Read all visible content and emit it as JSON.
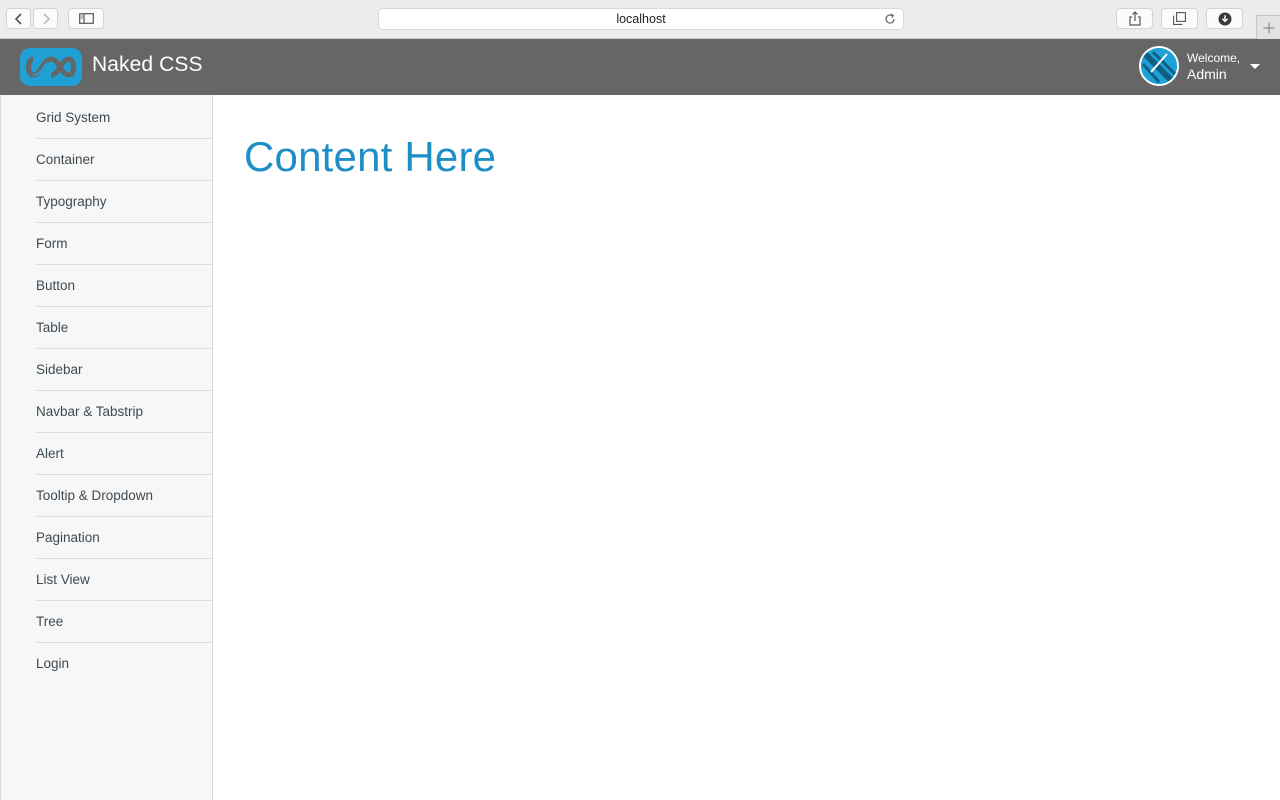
{
  "browser": {
    "address": "localhost",
    "icons": {
      "back": "chevron-left-icon",
      "forward": "chevron-right-icon",
      "sidebar": "sidebar-toggle-icon",
      "reload": "reload-icon",
      "share": "share-icon",
      "tabs": "tabs-overview-icon",
      "downloads": "download-icon",
      "new_tab": "plus-icon"
    }
  },
  "header": {
    "brand": "Naked CSS",
    "welcome": "Welcome,",
    "user": "Admin",
    "colors": {
      "bar": "#666666",
      "logo": "#1fa1d6"
    }
  },
  "sidebar": {
    "items": [
      {
        "label": "Grid System"
      },
      {
        "label": "Container"
      },
      {
        "label": "Typography"
      },
      {
        "label": "Form"
      },
      {
        "label": "Button"
      },
      {
        "label": "Table"
      },
      {
        "label": "Sidebar"
      },
      {
        "label": "Navbar & Tabstrip"
      },
      {
        "label": "Alert"
      },
      {
        "label": "Tooltip & Dropdown"
      },
      {
        "label": "Pagination"
      },
      {
        "label": "List View"
      },
      {
        "label": "Tree"
      },
      {
        "label": "Login"
      }
    ]
  },
  "main": {
    "heading": "Content Here",
    "heading_color": "#1e8ec7"
  }
}
